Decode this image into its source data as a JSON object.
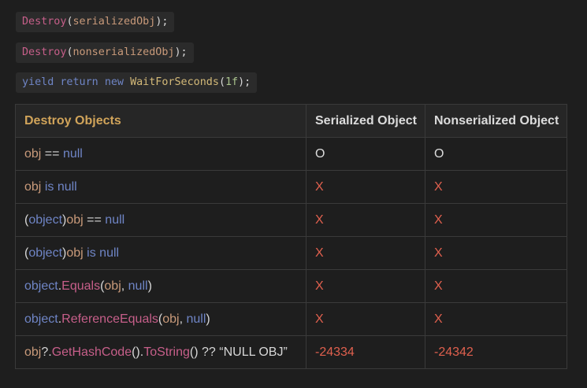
{
  "code_lines": [
    {
      "fn": "Destroy",
      "open": "(",
      "arg": "serializedObj",
      "close": ");"
    },
    {
      "fn": "Destroy",
      "open": "(",
      "arg": "nonserializedObj",
      "close": ");"
    },
    {
      "kw1": "yield",
      "kw2": "return",
      "kw3": "new",
      "cls": "WaitForSeconds",
      "open": "(",
      "num": "1f",
      "close": ");"
    }
  ],
  "table": {
    "headers": [
      "Destroy Objects",
      "Serialized Object",
      "Nonserialized Object"
    ],
    "rows": [
      {
        "expr": [
          [
            "var",
            "obj"
          ],
          [
            "op",
            " == "
          ],
          [
            "kw",
            "null"
          ]
        ],
        "serialized": "O",
        "nonserialized": "O"
      },
      {
        "expr": [
          [
            "var",
            "obj"
          ],
          [
            "op",
            " "
          ],
          [
            "kw",
            "is null"
          ]
        ],
        "serialized": "X",
        "nonserialized": "X"
      },
      {
        "expr": [
          [
            "op",
            "("
          ],
          [
            "kw",
            "object"
          ],
          [
            "op",
            ")"
          ],
          [
            "var",
            "obj"
          ],
          [
            "op",
            " == "
          ],
          [
            "kw",
            "null"
          ]
        ],
        "serialized": "X",
        "nonserialized": "X"
      },
      {
        "expr": [
          [
            "op",
            "("
          ],
          [
            "kw",
            "object"
          ],
          [
            "op",
            ")"
          ],
          [
            "var",
            "obj"
          ],
          [
            "op",
            " "
          ],
          [
            "kw",
            "is null"
          ]
        ],
        "serialized": "X",
        "nonserialized": "X"
      },
      {
        "expr": [
          [
            "kw",
            "object"
          ],
          [
            "op",
            "."
          ],
          [
            "fn",
            "Equals"
          ],
          [
            "op",
            "("
          ],
          [
            "var",
            "obj"
          ],
          [
            "op",
            ", "
          ],
          [
            "kw",
            "null"
          ],
          [
            "op",
            ")"
          ]
        ],
        "serialized": "X",
        "nonserialized": "X"
      },
      {
        "expr": [
          [
            "kw",
            "object"
          ],
          [
            "op",
            "."
          ],
          [
            "fn",
            "ReferenceEquals"
          ],
          [
            "op",
            "("
          ],
          [
            "var",
            "obj"
          ],
          [
            "op",
            ", "
          ],
          [
            "kw",
            "null"
          ],
          [
            "op",
            ")"
          ]
        ],
        "serialized": "X",
        "nonserialized": "X"
      },
      {
        "expr": [
          [
            "var",
            "obj"
          ],
          [
            "op",
            "?."
          ],
          [
            "fn",
            "GetHashCode"
          ],
          [
            "op",
            "()."
          ],
          [
            "fn",
            "ToString"
          ],
          [
            "op",
            "() ?? "
          ],
          [
            "str",
            "“NULL OBJ”"
          ]
        ],
        "serialized": "-24334",
        "nonserialized": "-24342"
      }
    ]
  },
  "colors": {
    "background": "#1e1e1e",
    "keyword": "#6f85c6",
    "function": "#c75f8a",
    "variable": "#c99a7a",
    "header_accent": "#d1a45a",
    "fail": "#e0604e"
  }
}
